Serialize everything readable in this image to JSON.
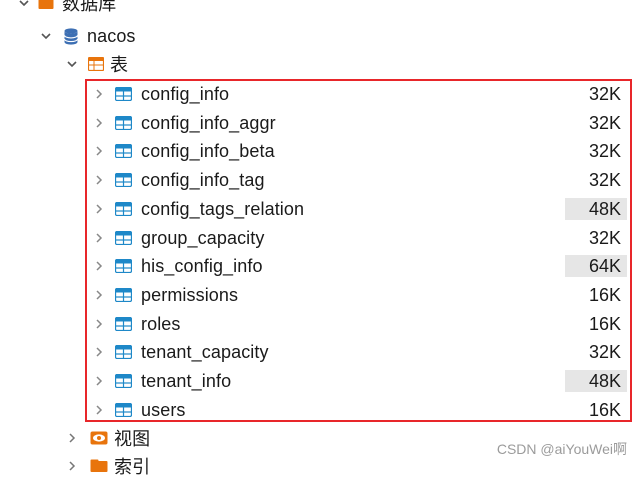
{
  "tree": {
    "database_group_label": "数据库",
    "database_name": "nacos",
    "tables_label": "表",
    "views_label": "视图",
    "indexes_label": "索引",
    "tables": [
      {
        "name": "config_info",
        "size": "32K",
        "highlight": false
      },
      {
        "name": "config_info_aggr",
        "size": "32K",
        "highlight": false
      },
      {
        "name": "config_info_beta",
        "size": "32K",
        "highlight": false
      },
      {
        "name": "config_info_tag",
        "size": "32K",
        "highlight": false
      },
      {
        "name": "config_tags_relation",
        "size": "48K",
        "highlight": true
      },
      {
        "name": "group_capacity",
        "size": "32K",
        "highlight": false
      },
      {
        "name": "his_config_info",
        "size": "64K",
        "highlight": true
      },
      {
        "name": "permissions",
        "size": "16K",
        "highlight": false
      },
      {
        "name": "roles",
        "size": "16K",
        "highlight": false
      },
      {
        "name": "tenant_capacity",
        "size": "32K",
        "highlight": false
      },
      {
        "name": "tenant_info",
        "size": "48K",
        "highlight": true
      },
      {
        "name": "users",
        "size": "16K",
        "highlight": false
      }
    ]
  },
  "watermark": "CSDN @aiYouWei啊",
  "colors": {
    "table_icon": "#1e88c8",
    "folder_icon": "#e8740c",
    "database_icon": "#3d6fb3",
    "annotation_box": "#e8262a",
    "size_highlight_bg": "#e6e6e6"
  }
}
